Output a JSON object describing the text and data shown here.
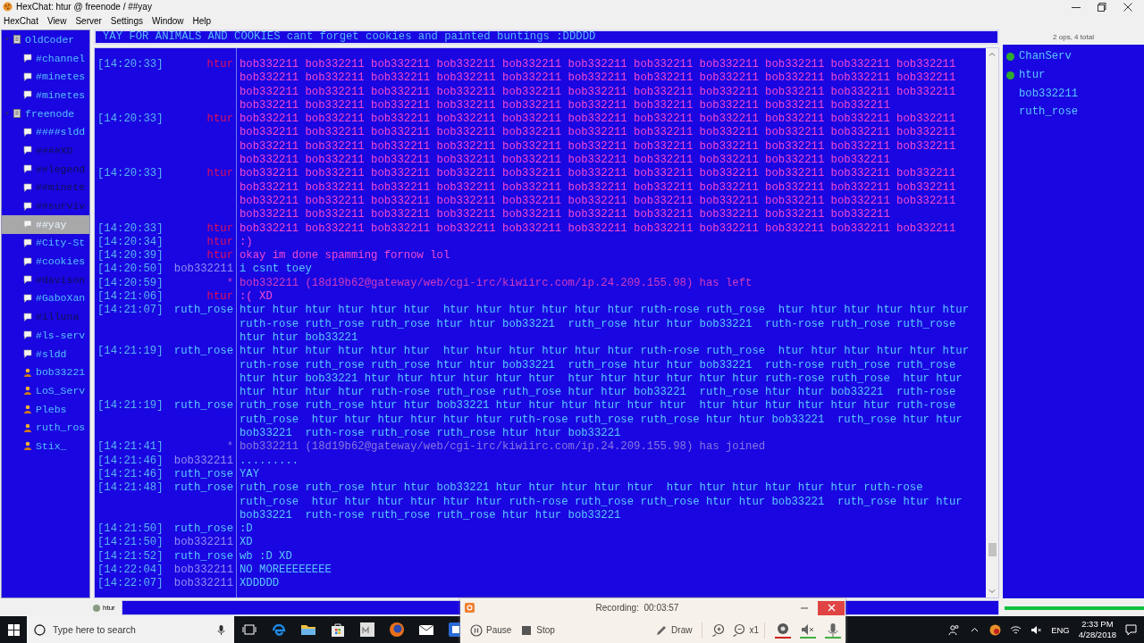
{
  "window": {
    "title": "HexChat: htur @ freenode / ##yay"
  },
  "menu": [
    "HexChat",
    "View",
    "Server",
    "Settings",
    "Window",
    "Help"
  ],
  "servers": [
    {
      "label": "OldCoder",
      "kind": "server",
      "selected": false,
      "dimmed": false,
      "expanded": true,
      "children": [
        {
          "label": "#channel",
          "kind": "channel",
          "selected": false,
          "dimmed": false
        },
        {
          "label": "#minetes",
          "kind": "channel",
          "selected": false,
          "dimmed": false
        },
        {
          "label": "#minetes",
          "kind": "channel",
          "selected": false,
          "dimmed": false
        }
      ]
    },
    {
      "label": "freenode",
      "kind": "server",
      "selected": false,
      "dimmed": false,
      "expanded": true,
      "children": [
        {
          "label": "####sldd",
          "kind": "channel",
          "selected": false,
          "dimmed": false
        },
        {
          "label": "####XD",
          "kind": "channel",
          "selected": false,
          "dimmed": true
        },
        {
          "label": "##legend",
          "kind": "channel",
          "selected": false,
          "dimmed": true
        },
        {
          "label": "##minete",
          "kind": "channel",
          "selected": false,
          "dimmed": true
        },
        {
          "label": "##surviv",
          "kind": "channel",
          "selected": false,
          "dimmed": true
        },
        {
          "label": "##yay",
          "kind": "channel",
          "selected": true,
          "dimmed": false
        },
        {
          "label": "#City-St",
          "kind": "channel",
          "selected": false,
          "dimmed": false
        },
        {
          "label": "#cookies",
          "kind": "channel",
          "selected": false,
          "dimmed": false
        },
        {
          "label": "#davison",
          "kind": "channel",
          "selected": false,
          "dimmed": true
        },
        {
          "label": "#GaboXan",
          "kind": "channel",
          "selected": false,
          "dimmed": false
        },
        {
          "label": "#illuna",
          "kind": "channel",
          "selected": false,
          "dimmed": true
        },
        {
          "label": "#ls-serv",
          "kind": "channel",
          "selected": false,
          "dimmed": false
        },
        {
          "label": "#sldd",
          "kind": "channel",
          "selected": false,
          "dimmed": false
        },
        {
          "label": "bob33221",
          "kind": "query",
          "selected": false,
          "dimmed": false
        },
        {
          "label": "LoS_Serv",
          "kind": "query",
          "selected": false,
          "dimmed": false
        },
        {
          "label": "Plebs",
          "kind": "query",
          "selected": false,
          "dimmed": false
        },
        {
          "label": "ruth_ros",
          "kind": "query",
          "selected": false,
          "dimmed": false
        },
        {
          "label": "Stix_",
          "kind": "query",
          "selected": false,
          "dimmed": false
        }
      ]
    }
  ],
  "topic": "YAY FOR ANIMALS AND COOKIES cant forget cookies and painted buntings :DDDDD",
  "messages": [
    {
      "time": "[14:20:33]",
      "nick": "htur",
      "color": "#e0105a",
      "text": {
        "color": "#f24ad2",
        "lines": [
          "bob332211 bob332211 bob332211 bob332211 bob332211 bob332211 bob332211 bob332211 bob332211 bob332211 bob332211",
          "bob332211 bob332211 bob332211 bob332211 bob332211 bob332211 bob332211 bob332211 bob332211 bob332211 bob332211",
          "bob332211 bob332211 bob332211 bob332211 bob332211 bob332211 bob332211 bob332211 bob332211 bob332211 bob332211",
          "bob332211 bob332211 bob332211 bob332211 bob332211 bob332211 bob332211 bob332211 bob332211 bob332211"
        ]
      }
    },
    {
      "time": "[14:20:33]",
      "nick": "htur",
      "color": "#e0105a",
      "text": {
        "color": "#f24ad2",
        "lines": [
          "bob332211 bob332211 bob332211 bob332211 bob332211 bob332211 bob332211 bob332211 bob332211 bob332211 bob332211",
          "bob332211 bob332211 bob332211 bob332211 bob332211 bob332211 bob332211 bob332211 bob332211 bob332211 bob332211",
          "bob332211 bob332211 bob332211 bob332211 bob332211 bob332211 bob332211 bob332211 bob332211 bob332211 bob332211",
          "bob332211 bob332211 bob332211 bob332211 bob332211 bob332211 bob332211 bob332211 bob332211 bob332211"
        ]
      }
    },
    {
      "time": "[14:20:33]",
      "nick": "htur",
      "color": "#e0105a",
      "text": {
        "color": "#f24ad2",
        "lines": [
          "bob332211 bob332211 bob332211 bob332211 bob332211 bob332211 bob332211 bob332211 bob332211 bob332211 bob332211",
          "bob332211 bob332211 bob332211 bob332211 bob332211 bob332211 bob332211 bob332211 bob332211 bob332211 bob332211",
          "bob332211 bob332211 bob332211 bob332211 bob332211 bob332211 bob332211 bob332211 bob332211 bob332211 bob332211",
          "bob332211 bob332211 bob332211 bob332211 bob332211 bob332211 bob332211 bob332211 bob332211 bob332211"
        ]
      }
    },
    {
      "time": "[14:20:33]",
      "nick": "htur",
      "color": "#e0105a",
      "text": {
        "color": "#f24ad2",
        "lines": [
          "bob332211 bob332211 bob332211 bob332211 bob332211 bob332211 bob332211 bob332211 bob332211 bob332211 bob332211"
        ]
      }
    },
    {
      "time": "[14:20:34]",
      "nick": "htur",
      "color": "#e0105a",
      "text": {
        "color": "#f24ad2",
        "lines": [
          ":)"
        ]
      }
    },
    {
      "time": "[14:20:39]",
      "nick": "htur",
      "color": "#e0105a",
      "text": {
        "color": "#f24ad2",
        "lines": [
          "okay im done spamming fornow lol"
        ]
      }
    },
    {
      "time": "[14:20:50]",
      "nick": "bob332211",
      "color": "#8e8ef6",
      "text": {
        "color": "#5ac8ff",
        "lines": [
          "i csnt toey"
        ]
      }
    },
    {
      "time": "[14:20:59]",
      "nick": "*",
      "text": {
        "color": "#d03cc0",
        "lines": [
          "bob332211 (18d19b62@gateway/web/cgi-irc/kiwiirc.com/ip.24.209.155.98) has left"
        ]
      }
    },
    {
      "time": "[14:21:06]",
      "nick": "htur",
      "color": "#e0105a",
      "text": {
        "color": "#f24ad2",
        "lines": [
          ":( XD"
        ]
      }
    },
    {
      "time": "[14:21:07]",
      "nick": "ruth_rose",
      "color": "#5ac8ff",
      "text": {
        "color": "#5ac8ff",
        "lines": [
          "htur htur htur htur htur htur  htur htur htur htur htur htur ruth-rose ruth_rose  htur htur htur htur htur htur",
          "ruth-rose ruth_rose ruth_rose htur htur bob33221  ruth_rose htur htur bob33221  ruth-rose ruth_rose ruth_rose",
          "htur htur bob33221"
        ]
      }
    },
    {
      "time": "[14:21:19]",
      "nick": "ruth_rose",
      "color": "#5ac8ff",
      "text": {
        "color": "#5ac8ff",
        "lines": [
          "htur htur htur htur htur htur  htur htur htur htur htur htur ruth-rose ruth_rose  htur htur htur htur htur htur",
          "ruth-rose ruth_rose ruth_rose htur htur bob33221  ruth_rose htur htur bob33221  ruth-rose ruth_rose ruth_rose",
          "htur htur bob33221 htur htur htur htur htur htur  htur htur htur htur htur htur ruth-rose ruth_rose  htur htur",
          "htur htur htur htur ruth-rose ruth_rose ruth_rose htur htur bob33221  ruth_rose htur htur bob33221  ruth-rose"
        ]
      }
    },
    {
      "time": "[14:21:19]",
      "nick": "ruth_rose",
      "color": "#5ac8ff",
      "text": {
        "color": "#5ac8ff",
        "lines": [
          "ruth_rose ruth_rose htur htur bob33221 htur htur htur htur htur htur  htur htur htur htur htur htur ruth-rose",
          "ruth_rose  htur htur htur htur htur htur ruth-rose ruth_rose ruth_rose htur htur bob33221  ruth_rose htur htur",
          "bob33221  ruth-rose ruth_rose ruth_rose htur htur bob33221"
        ]
      }
    },
    {
      "time": "[14:21:41]",
      "nick": "*",
      "text": {
        "color": "#8878e0",
        "lines": [
          "bob332211 (18d19b62@gateway/web/cgi-irc/kiwiirc.com/ip.24.209.155.98) has joined"
        ]
      }
    },
    {
      "time": "[14:21:46]",
      "nick": "bob332211",
      "color": "#8e8ef6",
      "text": {
        "color": "#5ac8ff",
        "lines": [
          "........."
        ]
      }
    },
    {
      "time": "[14:21:46]",
      "nick": "ruth_rose",
      "color": "#5ac8ff",
      "text": {
        "color": "#5ac8ff",
        "lines": [
          "YAY"
        ]
      }
    },
    {
      "time": "[14:21:48]",
      "nick": "ruth_rose",
      "color": "#5ac8ff",
      "text": {
        "color": "#5ac8ff",
        "lines": [
          "ruth_rose ruth_rose htur htur bob33221 htur htur htur htur htur  htur htur htur htur htur htur ruth-rose",
          "ruth_rose  htur htur htur htur htur htur ruth-rose ruth_rose ruth_rose htur htur bob33221  ruth_rose htur htur",
          "bob33221  ruth-rose ruth_rose ruth_rose htur htur bob33221"
        ]
      }
    },
    {
      "time": "[14:21:50]",
      "nick": "ruth_rose",
      "color": "#5ac8ff",
      "text": {
        "color": "#5ac8ff",
        "lines": [
          ":D"
        ]
      }
    },
    {
      "time": "[14:21:50]",
      "nick": "bob332211",
      "color": "#8e8ef6",
      "text": {
        "color": "#5ac8ff",
        "lines": [
          "XD"
        ]
      }
    },
    {
      "time": "[14:21:52]",
      "nick": "ruth_rose",
      "color": "#5ac8ff",
      "text": {
        "color": "#5ac8ff",
        "lines": [
          "wb :D XD"
        ]
      }
    },
    {
      "time": "[14:22:04]",
      "nick": "bob332211",
      "color": "#8e8ef6",
      "text": {
        "color": "#5ac8ff",
        "lines": [
          "NO MOREEEEEEEE"
        ]
      }
    },
    {
      "time": "[14:22:07]",
      "nick": "bob332211",
      "color": "#8e8ef6",
      "text": {
        "color": "#5ac8ff",
        "lines": [
          "XDDDDD"
        ]
      }
    }
  ],
  "userlist": {
    "summary": "2 ops, 4 total",
    "users": [
      {
        "name": "ChanServ",
        "op": true
      },
      {
        "name": "htur",
        "op": true
      },
      {
        "name": "bob332211",
        "op": false
      },
      {
        "name": "ruth_rose",
        "op": false
      }
    ]
  },
  "input": {
    "nick": "htur"
  },
  "lag_meter": {
    "level": 1
  },
  "recorder": {
    "title": "Recording:",
    "elapsed": "00:03:57",
    "buttons": [
      {
        "kind": "pause",
        "label": "Pause"
      },
      {
        "kind": "stop",
        "label": "Stop"
      },
      {
        "kind": "draw",
        "label": "Draw"
      }
    ],
    "zoom": "x1"
  },
  "taskbar": {
    "search_placeholder": "Type here to search",
    "language": "ENG",
    "time": "2:33 PM",
    "date": "4/28/2018"
  }
}
